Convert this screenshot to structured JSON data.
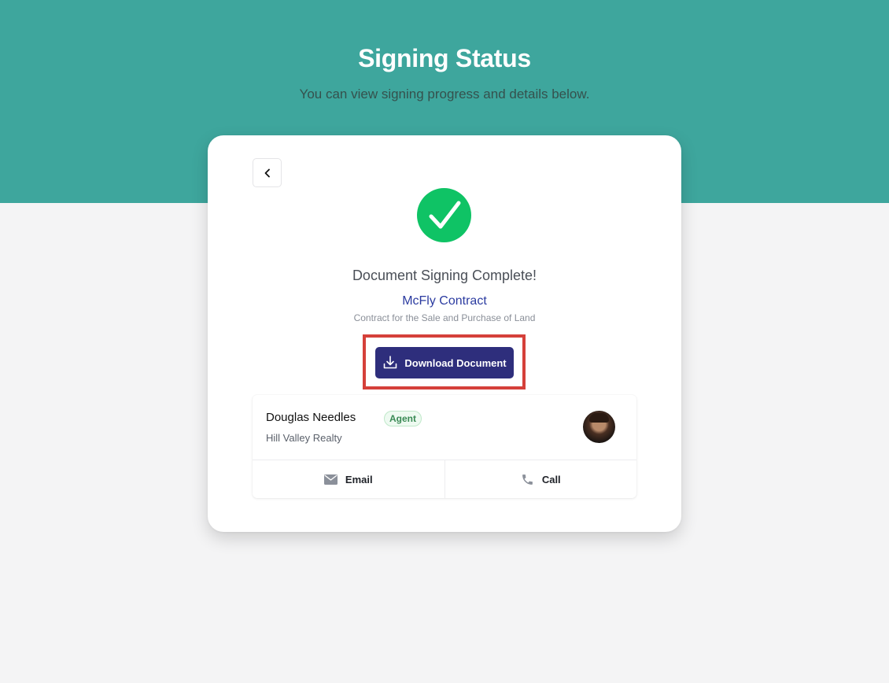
{
  "header": {
    "title": "Signing Status",
    "subtitle": "You can view signing progress and details below."
  },
  "card": {
    "status_text": "Document Signing Complete!",
    "document_name": "McFly Contract",
    "document_description": "Contract for the Sale and Purchase of Land",
    "download_label": "Download Document"
  },
  "agent": {
    "name": "Douglas Needles",
    "role": "Agent",
    "company": "Hill Valley Realty",
    "email_label": "Email",
    "call_label": "Call"
  },
  "colors": {
    "header_bg": "#3ea69d",
    "success": "#0fc365",
    "primary_button": "#2e2e7c",
    "link_text": "#2b3ba0",
    "highlight": "#d5403a"
  },
  "icons": [
    "back-chevron-icon",
    "checkmark-icon",
    "download-icon",
    "mail-icon",
    "phone-icon"
  ]
}
